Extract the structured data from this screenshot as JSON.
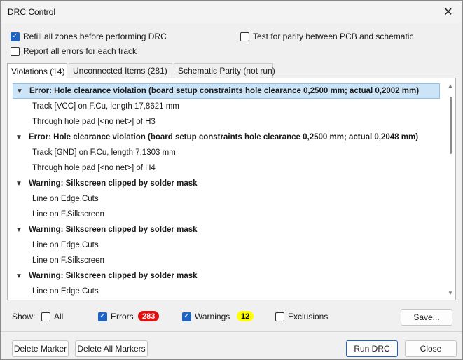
{
  "window": {
    "title": "DRC Control"
  },
  "options": {
    "refill_zones": {
      "label": "Refill all zones before performing DRC",
      "checked": true
    },
    "report_all_errors": {
      "label": "Report all errors for each track",
      "checked": false
    },
    "test_parity": {
      "label": "Test for parity between PCB and schematic",
      "checked": false
    }
  },
  "tabs": [
    {
      "label": "Violations (14)",
      "active": true
    },
    {
      "label": "Unconnected Items (281)",
      "active": false
    },
    {
      "label": "Schematic Parity (not run)",
      "active": false
    }
  ],
  "violations": [
    {
      "header": "Error: Hole clearance violation (board setup constraints hole clearance 0,2500 mm; actual 0,2002 mm)",
      "selected": true,
      "items": [
        "Track [VCC] on F.Cu, length 17,8621 mm",
        "Through hole pad [<no net>] of H3"
      ]
    },
    {
      "header": "Error: Hole clearance violation (board setup constraints hole clearance 0,2500 mm; actual 0,2048 mm)",
      "selected": false,
      "items": [
        "Track [GND] on F.Cu, length 7,1303 mm",
        "Through hole pad [<no net>] of H4"
      ]
    },
    {
      "header": "Warning: Silkscreen clipped by solder mask",
      "selected": false,
      "items": [
        "Line on Edge.Cuts",
        "Line on F.Silkscreen"
      ]
    },
    {
      "header": "Warning: Silkscreen clipped by solder mask",
      "selected": false,
      "items": [
        "Line on Edge.Cuts",
        "Line on F.Silkscreen"
      ]
    },
    {
      "header": "Warning: Silkscreen clipped by solder mask",
      "selected": false,
      "items": [
        "Line on Edge.Cuts"
      ]
    }
  ],
  "filters": {
    "show_label": "Show:",
    "all": {
      "label": "All",
      "checked": false
    },
    "errors": {
      "label": "Errors",
      "checked": true,
      "count": "283"
    },
    "warnings": {
      "label": "Warnings",
      "checked": true,
      "count": "12"
    },
    "exclusions": {
      "label": "Exclusions",
      "checked": false
    }
  },
  "buttons": {
    "save": "Save...",
    "delete_marker": "Delete Marker",
    "delete_all_markers": "Delete All Markers",
    "run_drc": "Run DRC",
    "close": "Close"
  },
  "colors": {
    "accent": "#1e62c4",
    "error_badge": "#e01010",
    "warning_badge": "#ffff00",
    "selection": "#cce4f7"
  }
}
